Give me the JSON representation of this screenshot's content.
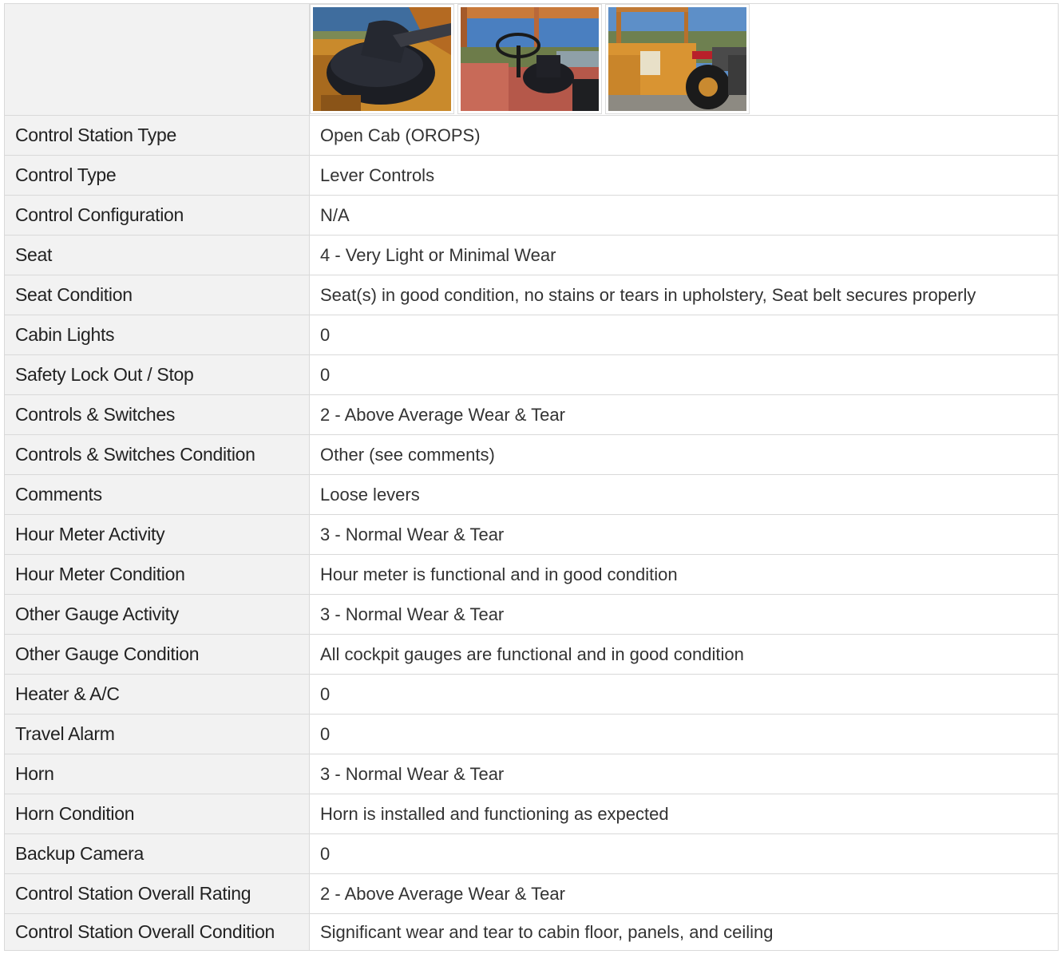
{
  "photos": [
    {
      "icon": "photo-seat-closeup"
    },
    {
      "icon": "photo-cab-steering-wheel"
    },
    {
      "icon": "photo-tractor-side"
    }
  ],
  "rows": [
    {
      "label": "Control Station Type",
      "value": "Open Cab (OROPS)"
    },
    {
      "label": "Control Type",
      "value": "Lever Controls"
    },
    {
      "label": "Control Configuration",
      "value": "N/A"
    },
    {
      "label": "Seat",
      "value": "4 - Very Light or Minimal Wear"
    },
    {
      "label": "Seat Condition",
      "value": "Seat(s) in good condition, no stains or tears in upholstery, Seat belt secures properly"
    },
    {
      "label": "Cabin Lights",
      "value": "0"
    },
    {
      "label": "Safety Lock Out / Stop",
      "value": "0"
    },
    {
      "label": "Controls & Switches",
      "value": "2 - Above Average Wear & Tear"
    },
    {
      "label": "Controls & Switches Condition",
      "value": "Other (see comments)"
    },
    {
      "label": "Comments",
      "value": "Loose levers"
    },
    {
      "label": "Hour Meter Activity",
      "value": "3 - Normal Wear & Tear"
    },
    {
      "label": "Hour Meter Condition",
      "value": "Hour meter is functional and in good condition"
    },
    {
      "label": "Other Gauge Activity",
      "value": "3 - Normal Wear & Tear"
    },
    {
      "label": "Other Gauge Condition",
      "value": "All cockpit gauges are functional and in good condition"
    },
    {
      "label": "Heater & A/C",
      "value": "0"
    },
    {
      "label": "Travel Alarm",
      "value": "0"
    },
    {
      "label": "Horn",
      "value": "3 - Normal Wear & Tear"
    },
    {
      "label": "Horn Condition",
      "value": "Horn is installed and functioning as expected"
    },
    {
      "label": "Backup Camera",
      "value": "0"
    },
    {
      "label": "Control Station Overall Rating",
      "value": "2 - Above Average Wear & Tear"
    },
    {
      "label": "Control Station Overall Condition",
      "value": "Significant wear and tear to cabin floor, panels, and ceiling"
    }
  ]
}
